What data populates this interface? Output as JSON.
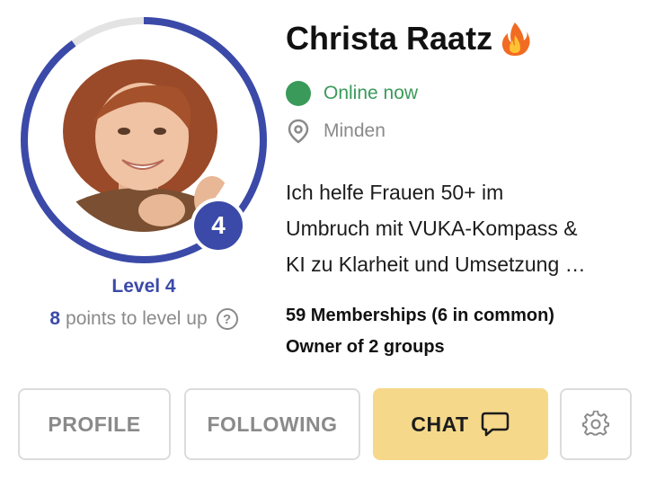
{
  "profile": {
    "name": "Christa Raatz",
    "name_emoji_icon": "fire-icon",
    "status": "Online now",
    "status_color": "#3a9a5a",
    "location": "Minden",
    "bio_lines": [
      "Ich helfe Frauen 50+ im",
      "Umbruch mit VUKA-Kompass &",
      "KI zu Klarheit und Umsetzung …"
    ],
    "memberships": "59 Memberships (6 in common)",
    "owner": "Owner of 2 groups"
  },
  "level": {
    "badge_value": "4",
    "label": "Level 4",
    "points_value": "8",
    "points_text": "points to level up",
    "help_symbol": "?",
    "progress_fraction": 0.9,
    "accent_color": "#3b4aa8"
  },
  "actions": {
    "profile_label": "PROFILE",
    "following_label": "FOLLOWING",
    "chat_label": "CHAT",
    "chat_color": "#f5d88a",
    "settings_icon": "gear-icon"
  }
}
